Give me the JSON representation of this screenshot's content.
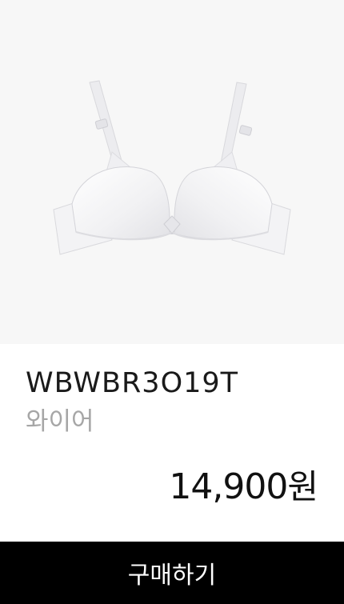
{
  "product": {
    "code": "WBWBR3O19T",
    "type": "와이어",
    "price_amount": "14,900",
    "price_unit": "원"
  },
  "actions": {
    "buy_label": "구매하기"
  }
}
